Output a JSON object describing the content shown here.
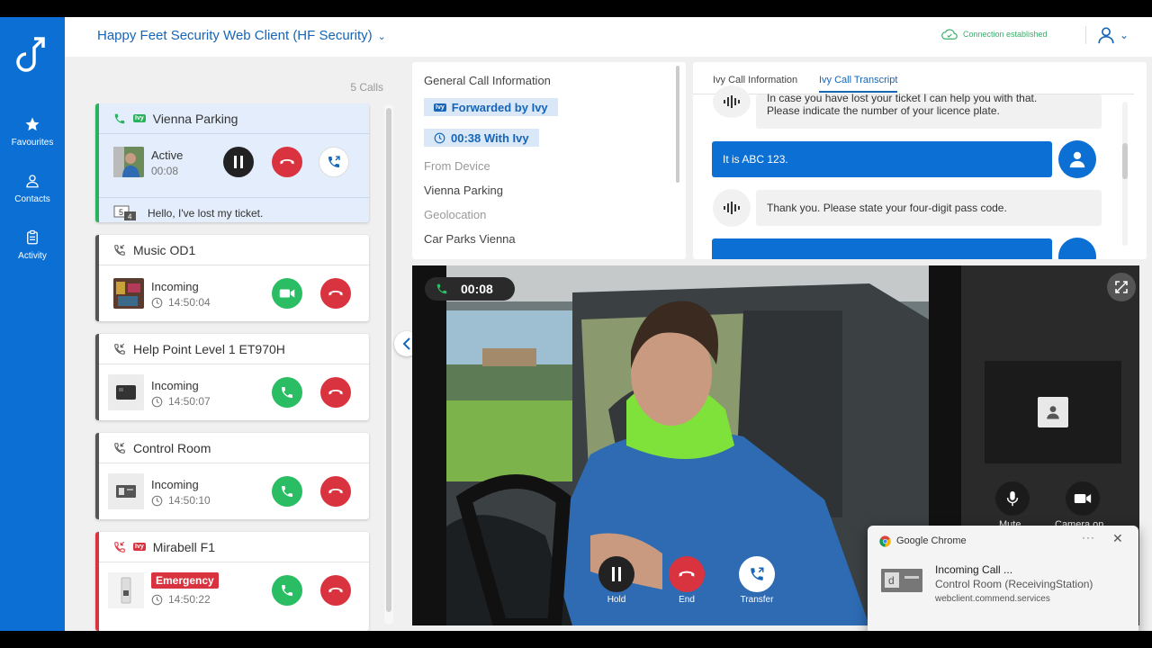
{
  "app": {
    "title": "Happy Feet Security Web Client (HF Security)",
    "connection_status": "Connection established",
    "accent_color": "#0c6fd4"
  },
  "nav": {
    "items": [
      {
        "label": "Favourites",
        "icon": "star-icon"
      },
      {
        "label": "Contacts",
        "icon": "person-icon"
      },
      {
        "label": "Activity",
        "icon": "clipboard-icon"
      }
    ]
  },
  "calls": {
    "count_label": "5 Calls",
    "items": [
      {
        "name": "Vienna Parking",
        "status": "Active",
        "time": "00:08",
        "message": "Hello, I've lost my ticket.",
        "badge": "ivy",
        "state": "active"
      },
      {
        "name": "Music OD1",
        "status": "Incoming",
        "time": "14:50:04"
      },
      {
        "name": "Help Point Level 1 ET970H",
        "status": "Incoming",
        "time": "14:50:07"
      },
      {
        "name": "Control Room",
        "status": "Incoming",
        "time": "14:50:10"
      },
      {
        "name": "Mirabell F1",
        "status": "Emergency",
        "time": "14:50:22",
        "badge": "ivy",
        "state": "emergency"
      }
    ]
  },
  "general_info": {
    "title": "General Call Information",
    "forwarded_label": "Forwarded by Ivy",
    "with_ivy_label": "00:38 With Ivy",
    "from_device_label": "From Device",
    "from_device_value": "Vienna Parking",
    "geolocation_label": "Geolocation",
    "geolocation_value": "Car Parks Vienna"
  },
  "transcript": {
    "tabs": [
      "Ivy Call Information",
      "Ivy Call Transcript"
    ],
    "selected_tab": "Ivy Call Transcript",
    "messages": [
      {
        "from": "ivy",
        "line1": "In case you have lost your ticket I can help you with that.",
        "line2": "Please indicate the number of your licence plate."
      },
      {
        "from": "caller",
        "text": "It is ABC 123."
      },
      {
        "from": "ivy",
        "text": "Thank you. Please state your four-digit pass code."
      }
    ]
  },
  "video": {
    "timer": "00:08",
    "controls": [
      {
        "label": "Hold",
        "icon": "pause-icon"
      },
      {
        "label": "End",
        "icon": "hangup-icon"
      },
      {
        "label": "Transfer",
        "icon": "transfer-icon"
      }
    ],
    "side_controls": [
      {
        "label": "Mute",
        "icon": "microphone-icon"
      },
      {
        "label": "Camera on",
        "icon": "camera-icon"
      }
    ]
  },
  "notification": {
    "source": "Google Chrome",
    "title": "Incoming Call ...",
    "subtitle": "Control Room (ReceivingStation)",
    "origin": "webclient.commend.services"
  }
}
